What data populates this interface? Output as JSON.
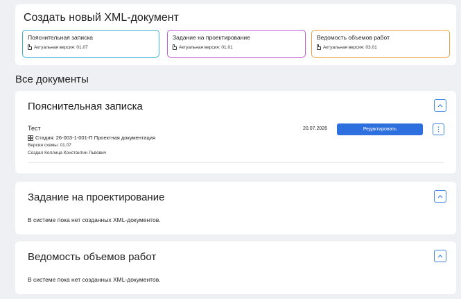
{
  "create": {
    "title": "Создать новый XML-документ",
    "cards": [
      {
        "name": "Пояснительная записка",
        "version": "Актуальная версия: 01.07",
        "color": "#3ab0d8"
      },
      {
        "name": "Задание на проектирование",
        "version": "Актуальная версия: 01.01",
        "color": "#c05ad8"
      },
      {
        "name": "Ведомость объемов работ",
        "version": "Актуальная версия: 03.01",
        "color": "#f0a23c"
      }
    ]
  },
  "all_docs": {
    "heading": "Все документы",
    "sections": [
      {
        "title": "Пояснительная записка",
        "document": {
          "name": "Тест",
          "stage": "Стадия: 26-003-1-001-П Проектная документация",
          "schema": "Версия схемы: 01.07",
          "author": "Создал Коллица Константин Львович",
          "date": "20.07.2026",
          "edit_label": "Редактировать"
        }
      },
      {
        "title": "Задание на проектирование",
        "empty": "В системе пока нет созданных XML-документов."
      },
      {
        "title": "Ведомость объемов работ",
        "empty": "В системе пока нет созданных XML-документов."
      }
    ]
  },
  "colors": {
    "accent": "#2e6fe0",
    "background": "#eef0f4"
  }
}
